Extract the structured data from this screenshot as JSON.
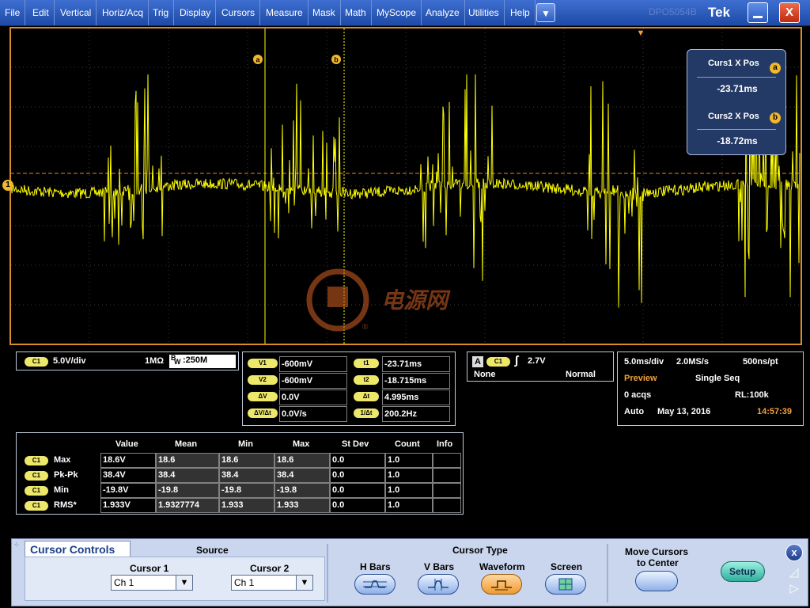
{
  "menu": {
    "items": [
      "File",
      "Edit",
      "Vertical",
      "Horiz/Acq",
      "Trig",
      "Display",
      "Cursors",
      "Measure",
      "Mask",
      "Math",
      "MyScope",
      "Analyze",
      "Utilities",
      "Help"
    ],
    "more_glyph": "▼",
    "model": "DPO5054B",
    "brand": "Tek",
    "close_glyph": "X"
  },
  "waveform": {
    "channel_marker": "1",
    "cursor_a_label": "a",
    "cursor_b_label": "b",
    "trigger_marker": "▼",
    "color": "#ffff00",
    "cursor_color": "#ffff00",
    "ref_line_color": "#e08a1c",
    "border_color": "#d98c2a"
  },
  "cursor_readout": {
    "curs1_label": "Curs1 X Pos",
    "curs1_badge": "a",
    "curs1_value": "-23.71ms",
    "curs2_label": "Curs2 X Pos",
    "curs2_badge": "b",
    "curs2_value": "-18.72ms"
  },
  "watermark": {
    "text": "电源网",
    "symbol": "®"
  },
  "channel_panel": {
    "badge": "C1",
    "scale": "5.0V/div",
    "impedance": "1MΩ",
    "bw_prefix": "B",
    "bw_sub": "W",
    "bw_value": ":250M"
  },
  "cursor_values": {
    "rows": [
      {
        "badge": "V1",
        "value": "-600mV",
        "badge2": "t1",
        "value2": "-23.71ms"
      },
      {
        "badge": "V2",
        "value": "-600mV",
        "badge2": "t2",
        "value2": "-18.715ms"
      },
      {
        "badge": "ΔV",
        "value": "0.0V",
        "badge2": "Δt",
        "value2": "4.995ms"
      },
      {
        "badge": "ΔV/Δt",
        "value": "0.0V/s",
        "badge2": "1/Δt",
        "value2": "200.2Hz"
      }
    ]
  },
  "trigger_panel": {
    "source_letter": "A",
    "badge": "C1",
    "slope_glyph": "∫",
    "level": "2.7V",
    "coupling": "None",
    "mode": "Normal"
  },
  "acq_panel": {
    "timebase": "5.0ms/div",
    "sample_rate": "2.0MS/s",
    "resolution": "500ns/pt",
    "preview": "Preview",
    "acq_mode": "Single Seq",
    "acqs": "0 acqs",
    "record_length": "RL:100k",
    "run_mode": "Auto",
    "date": "May 13, 2016",
    "time": "14:57:39",
    "preview_color": "#f2a03a"
  },
  "measurements": {
    "headers": [
      "Value",
      "Mean",
      "Min",
      "Max",
      "St Dev",
      "Count",
      "Info"
    ],
    "rows": [
      {
        "badge": "C1",
        "name": "Max",
        "cells": [
          "18.6V",
          "18.6",
          "18.6",
          "18.6",
          "0.0",
          "1.0",
          ""
        ]
      },
      {
        "badge": "C1",
        "name": "Pk-Pk",
        "cells": [
          "38.4V",
          "38.4",
          "38.4",
          "38.4",
          "0.0",
          "1.0",
          ""
        ]
      },
      {
        "badge": "C1",
        "name": "Min",
        "cells": [
          "-19.8V",
          "-19.8",
          "-19.8",
          "-19.8",
          "0.0",
          "1.0",
          ""
        ]
      },
      {
        "badge": "C1",
        "name": "RMS*",
        "cells": [
          "1.933V",
          "1.9327774",
          "1.933",
          "1.933",
          "0.0",
          "1.0",
          ""
        ]
      }
    ]
  },
  "cursor_controls": {
    "title": "Cursor Controls",
    "source_label": "Source",
    "cursor1_label": "Cursor 1",
    "cursor1_value": "Ch 1",
    "cursor2_label": "Cursor 2",
    "cursor2_value": "Ch 1",
    "dropdown_glyph": "▼",
    "type_label": "Cursor Type",
    "types": [
      "H Bars",
      "V Bars",
      "Waveform",
      "Screen"
    ],
    "selected_type": "Waveform",
    "move_label_line1": "Move Cursors",
    "move_label_line2": "to Center",
    "setup_label": "Setup",
    "close_glyph": "x"
  }
}
